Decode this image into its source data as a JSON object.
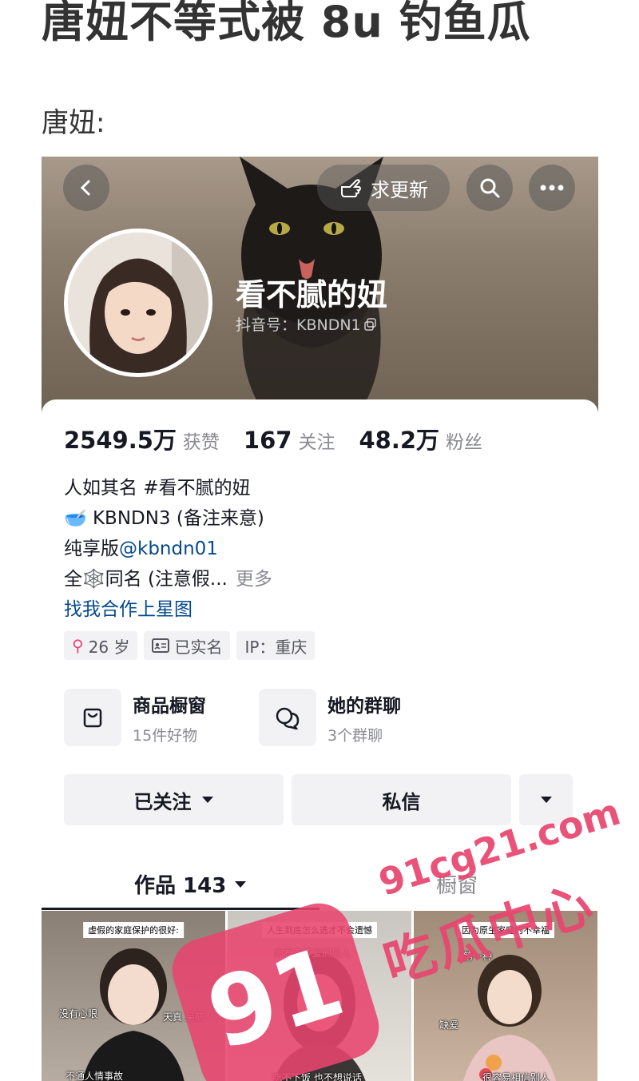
{
  "article": {
    "title": "唐妞不等式被 8u 钓鱼瓜",
    "subtitle": "唐妞:"
  },
  "header": {
    "request_update_label": "求更新",
    "back_icon": "chevron-left-icon",
    "search_icon": "search-icon",
    "more_icon": "ellipsis-icon"
  },
  "profile": {
    "nickname": "看不腻的妞",
    "douyin_id": "抖音号：KBNDN1",
    "stats": [
      {
        "value": "2549.5万",
        "label": "获赞"
      },
      {
        "value": "167",
        "label": "关注"
      },
      {
        "value": "48.2万",
        "label": "粉丝"
      }
    ],
    "bio": {
      "line1": "人如其名 #看不腻的妞",
      "line2": "KBNDN3 (备注来意)",
      "line3_prefix": "纯享版",
      "line3_link": "@kbndn01",
      "line4": "全",
      "line4_rest": "同名 (注意假...",
      "more": "更多",
      "line5": "找我合作上星图"
    },
    "tags": [
      {
        "text": "26 岁",
        "icon": "female-icon"
      },
      {
        "text": "已实名",
        "icon": "id-card-icon"
      },
      {
        "text": "IP：重庆",
        "icon": ""
      }
    ],
    "features": [
      {
        "title": "商品橱窗",
        "sub": "15件好物",
        "icon": "shopping-bag-icon"
      },
      {
        "title": "她的群聊",
        "sub": "3个群聊",
        "icon": "chat-bubbles-icon"
      }
    ],
    "actions": {
      "follow": "已关注",
      "message": "私信"
    },
    "tabs": {
      "works": "作品 143",
      "window": "橱窗"
    },
    "thumbs": [
      {
        "caption": "虚假的家庭保护的很好:",
        "side1": "没有心眼",
        "side2": "天真 呆萌",
        "bottom": "不通人情事故"
      },
      {
        "caption": "人生到底怎么选才不会遗憾",
        "side1": "你看着不爱的男人",
        "side2": "",
        "bottom": "吃不下饭 也不想说话"
      },
      {
        "caption": "因为原生家庭的不幸福",
        "side1": "缺爱",
        "side2": "第一种",
        "bottom": "很容易相信别人"
      }
    ]
  },
  "watermark": {
    "domain": "91cg21.com",
    "cn": "吃瓜中心",
    "logo": "91"
  },
  "colors": {
    "link": "#04498d",
    "muted": "#8a8b91",
    "watermark": "#e8446e"
  }
}
